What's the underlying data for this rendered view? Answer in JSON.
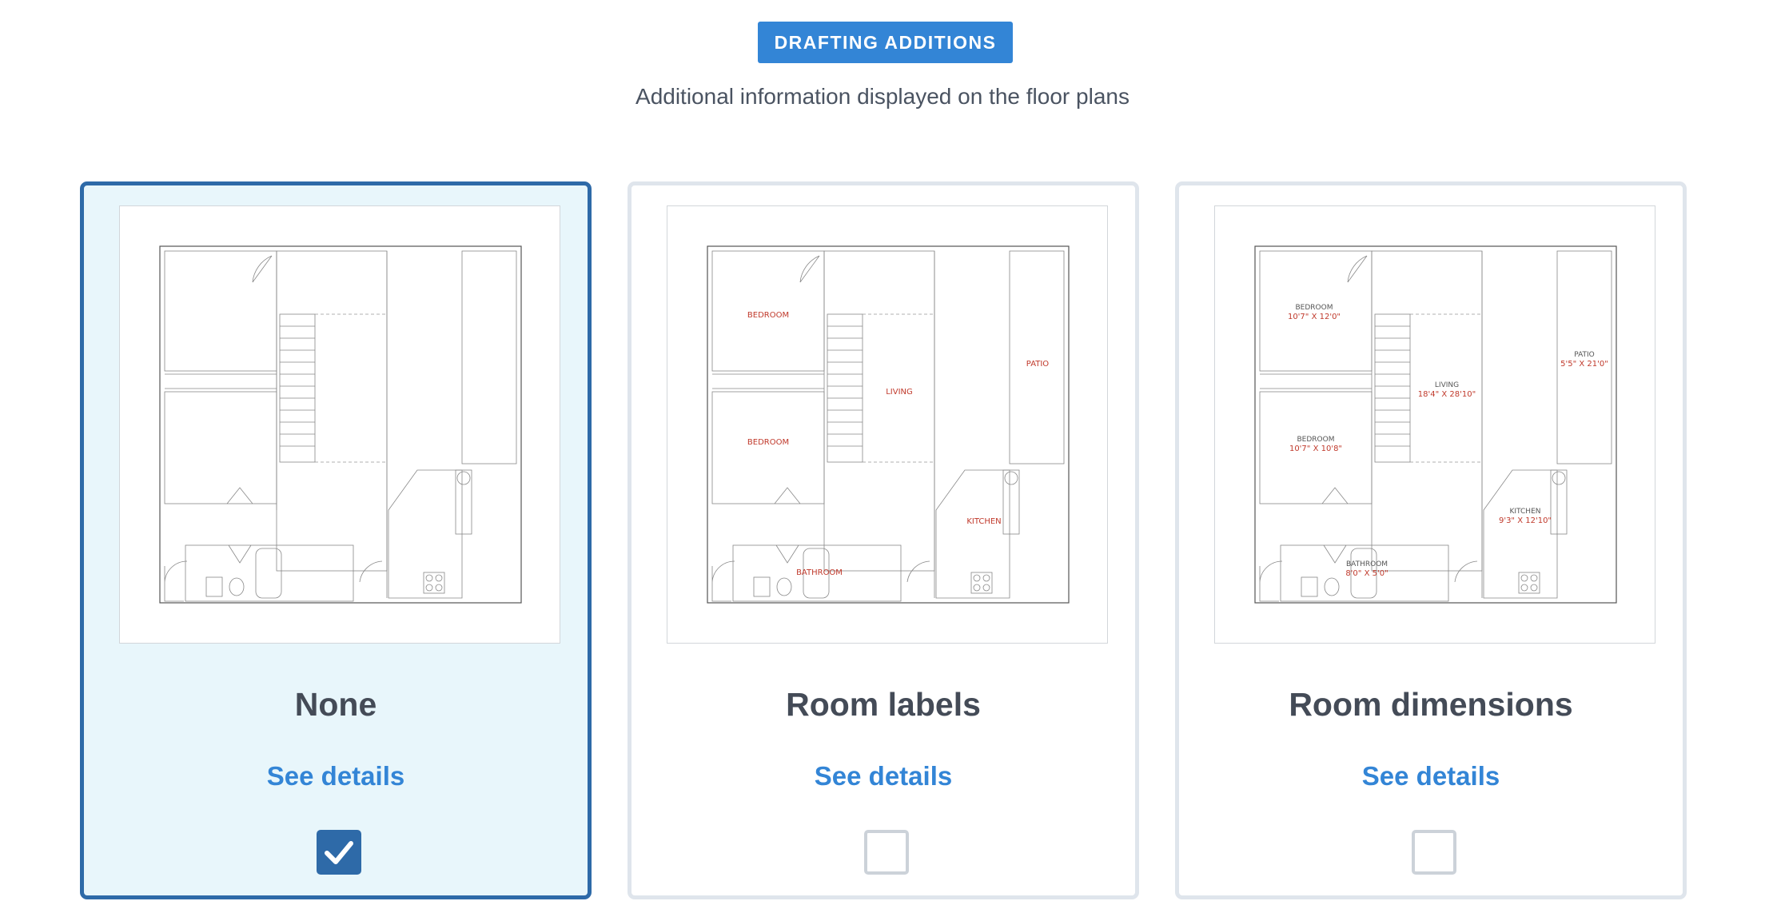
{
  "header": {
    "badge": "DRAFTING ADDITIONS",
    "subtitle": "Additional information displayed on the floor plans"
  },
  "options": [
    {
      "title": "None",
      "details_link": "See details",
      "selected": true,
      "labels": []
    },
    {
      "title": "Room labels",
      "details_link": "See details",
      "selected": false,
      "labels": [
        "BEDROOM",
        "BEDROOM",
        "LIVING",
        "PATIO",
        "KITCHEN",
        "BATHROOM"
      ]
    },
    {
      "title": "Room dimensions",
      "details_link": "See details",
      "selected": false,
      "labels": [
        "BEDROOM",
        "10'7\" X 12'0\"",
        "BEDROOM",
        "10'7\" X 10'8\"",
        "LIVING",
        "18'4\" X 28'10\"",
        "PATIO",
        "5'5\" X 21'0\"",
        "KITCHEN",
        "9'3\" X 12'10\"",
        "BATHROOM",
        "8'0\" X 5'0\""
      ]
    }
  ],
  "colors": {
    "accent": "#3385d6",
    "selected_border": "#2e6aa8",
    "selected_bg": "#e8f6fb",
    "label_red": "#c0392b"
  }
}
